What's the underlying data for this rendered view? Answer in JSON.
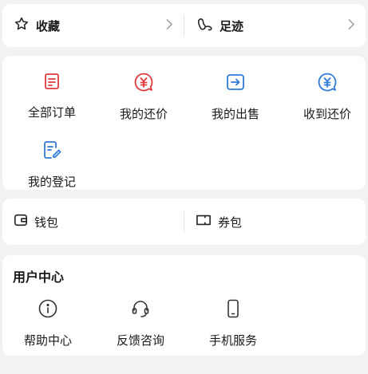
{
  "top_row": {
    "favorites_label": "收藏",
    "footprints_label": "足迹"
  },
  "orders": {
    "items": [
      {
        "label": "全部订单",
        "icon": "list-doc-icon",
        "color": "#e0393e"
      },
      {
        "label": "我的还价",
        "icon": "yuan-bubble-icon",
        "color": "#e0393e"
      },
      {
        "label": "我的出售",
        "icon": "arrow-box-icon",
        "color": "#2f7bd8"
      },
      {
        "label": "收到还价",
        "icon": "yuan-bubble-icon",
        "color": "#2f7bd8"
      },
      {
        "label": "我的登记",
        "icon": "doc-pen-icon",
        "color": "#2f7bd8"
      }
    ]
  },
  "wallet_row": {
    "wallet_label": "钱包",
    "coupon_label": "券包"
  },
  "user_center": {
    "title": "用户中心",
    "items": [
      {
        "label": "帮助中心",
        "icon": "info-circle-icon"
      },
      {
        "label": "反馈咨询",
        "icon": "headset-icon"
      },
      {
        "label": "手机服务",
        "icon": "phone-icon"
      }
    ]
  }
}
